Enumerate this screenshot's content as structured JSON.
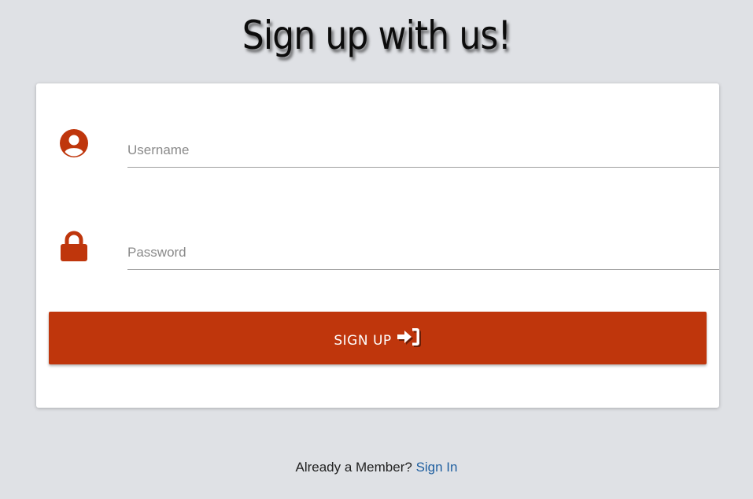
{
  "page": {
    "title": "Sign up with us!"
  },
  "form": {
    "username": {
      "placeholder": "Username",
      "value": "",
      "icon": "user-circle-icon"
    },
    "password": {
      "placeholder": "Password",
      "value": "",
      "icon": "lock-icon"
    },
    "submit": {
      "label": "SIGN UP",
      "icon": "sign-in-icon"
    }
  },
  "footer": {
    "prompt": "Already a Member?",
    "link_label": "Sign In"
  },
  "colors": {
    "background": "#dfe1e5",
    "card": "#ffffff",
    "accent": "#bf360c",
    "link": "#1f5fa0",
    "underline": "#9e9e9e"
  }
}
